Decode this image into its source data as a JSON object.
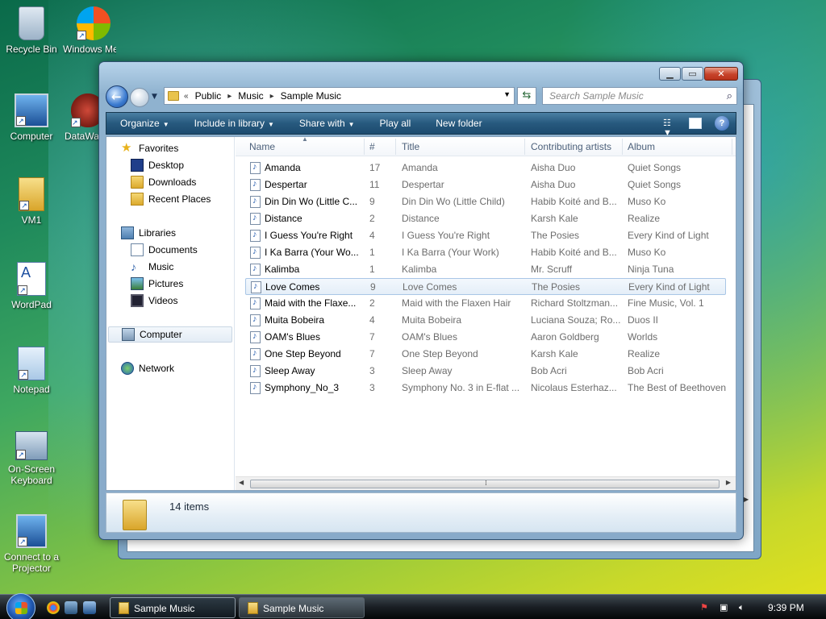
{
  "desktop": {
    "icons": [
      {
        "label": "Recycle Bin"
      },
      {
        "label": "Windows Media C"
      },
      {
        "label": "Computer"
      },
      {
        "label": "DataWa"
      },
      {
        "label": "VM1"
      },
      {
        "label": "WordPad"
      },
      {
        "label": "Notepad"
      },
      {
        "label": "On-Screen Keyboard"
      },
      {
        "label": "Connect to a Projector"
      }
    ]
  },
  "window": {
    "address": {
      "overflow": "«",
      "crumbs": [
        "Public",
        "Music",
        "Sample Music"
      ]
    },
    "search_placeholder": "Search Sample Music",
    "toolbar": {
      "organize": "Organize",
      "include": "Include in library",
      "share": "Share with",
      "play_all": "Play all",
      "new_folder": "New folder"
    },
    "nav": {
      "favorites": "Favorites",
      "desktop": "Desktop",
      "downloads": "Downloads",
      "recent": "Recent Places",
      "libraries": "Libraries",
      "documents": "Documents",
      "music": "Music",
      "pictures": "Pictures",
      "videos": "Videos",
      "computer": "Computer",
      "network": "Network"
    },
    "columns": {
      "name": "Name",
      "num": "#",
      "title": "Title",
      "artists": "Contributing artists",
      "album": "Album"
    },
    "files": [
      {
        "name": "Amanda",
        "num": "17",
        "title": "Amanda",
        "artist": "Aisha Duo",
        "album": "Quiet Songs"
      },
      {
        "name": "Despertar",
        "num": "11",
        "title": "Despertar",
        "artist": "Aisha Duo",
        "album": "Quiet Songs"
      },
      {
        "name": "Din Din Wo (Little C...",
        "num": "9",
        "title": "Din Din Wo (Little Child)",
        "artist": "Habib Koité and B...",
        "album": "Muso Ko"
      },
      {
        "name": "Distance",
        "num": "2",
        "title": "Distance",
        "artist": "Karsh Kale",
        "album": "Realize"
      },
      {
        "name": "I Guess You're Right",
        "num": "4",
        "title": "I Guess You're Right",
        "artist": "The Posies",
        "album": "Every Kind of Light"
      },
      {
        "name": "I Ka Barra (Your Wo...",
        "num": "1",
        "title": "I Ka Barra (Your Work)",
        "artist": "Habib Koité and B...",
        "album": "Muso Ko"
      },
      {
        "name": "Kalimba",
        "num": "1",
        "title": "Kalimba",
        "artist": "Mr. Scruff",
        "album": "Ninja Tuna"
      },
      {
        "name": "Love Comes",
        "num": "9",
        "title": "Love Comes",
        "artist": "The Posies",
        "album": "Every Kind of Light"
      },
      {
        "name": "Maid with the Flaxe...",
        "num": "2",
        "title": "Maid with the Flaxen Hair",
        "artist": "Richard Stoltzman...",
        "album": "Fine Music, Vol. 1"
      },
      {
        "name": "Muita Bobeira",
        "num": "4",
        "title": "Muita Bobeira",
        "artist": "Luciana Souza; Ro...",
        "album": "Duos II"
      },
      {
        "name": "OAM's Blues",
        "num": "7",
        "title": "OAM's Blues",
        "artist": "Aaron Goldberg",
        "album": "Worlds"
      },
      {
        "name": "One Step Beyond",
        "num": "7",
        "title": "One Step Beyond",
        "artist": "Karsh Kale",
        "album": "Realize"
      },
      {
        "name": "Sleep Away",
        "num": "3",
        "title": "Sleep Away",
        "artist": "Bob Acri",
        "album": "Bob Acri"
      },
      {
        "name": "Symphony_No_3",
        "num": "3",
        "title": "Symphony No. 3 in E-flat ...",
        "artist": "Nicolaus Esterhaz...",
        "album": "The Best of Beethoven"
      }
    ],
    "item_count": "14 items"
  },
  "taskbar": {
    "buttons": [
      "Sample Music",
      "Sample Music"
    ],
    "clock": "9:39 PM"
  }
}
